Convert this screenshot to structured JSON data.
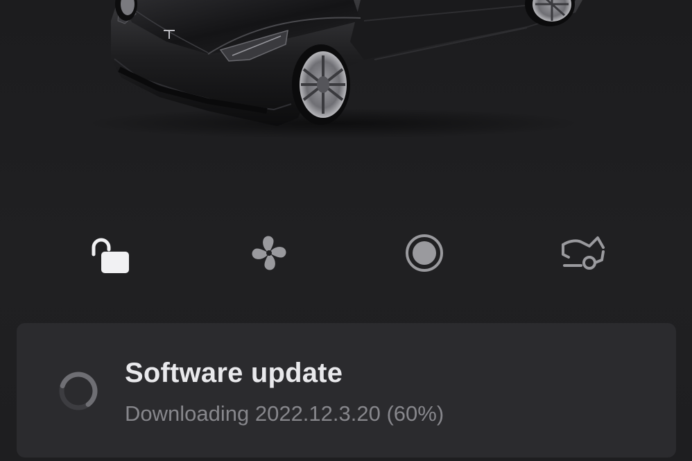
{
  "vehicle": {
    "image_icon": "car-render-icon"
  },
  "controls": [
    {
      "name": "lock",
      "icon": "unlocked-padlock-icon",
      "color": "#f1f1f3"
    },
    {
      "name": "climate",
      "icon": "fan-icon",
      "color": "#9a9a9e"
    },
    {
      "name": "sentry",
      "icon": "record-icon",
      "color": "#9a9a9e"
    },
    {
      "name": "trunk",
      "icon": "open-trunk-icon",
      "color": "#9a9a9e"
    }
  ],
  "update": {
    "title": "Software update",
    "status": "Downloading 2022.12.3.20 (60%)",
    "progress": 0.6,
    "icon": "spinner-icon"
  },
  "colors": {
    "background": "#1f1f21",
    "card": "#2b2b2e",
    "title": "#e9e9ec",
    "subtitle": "#87878c"
  }
}
